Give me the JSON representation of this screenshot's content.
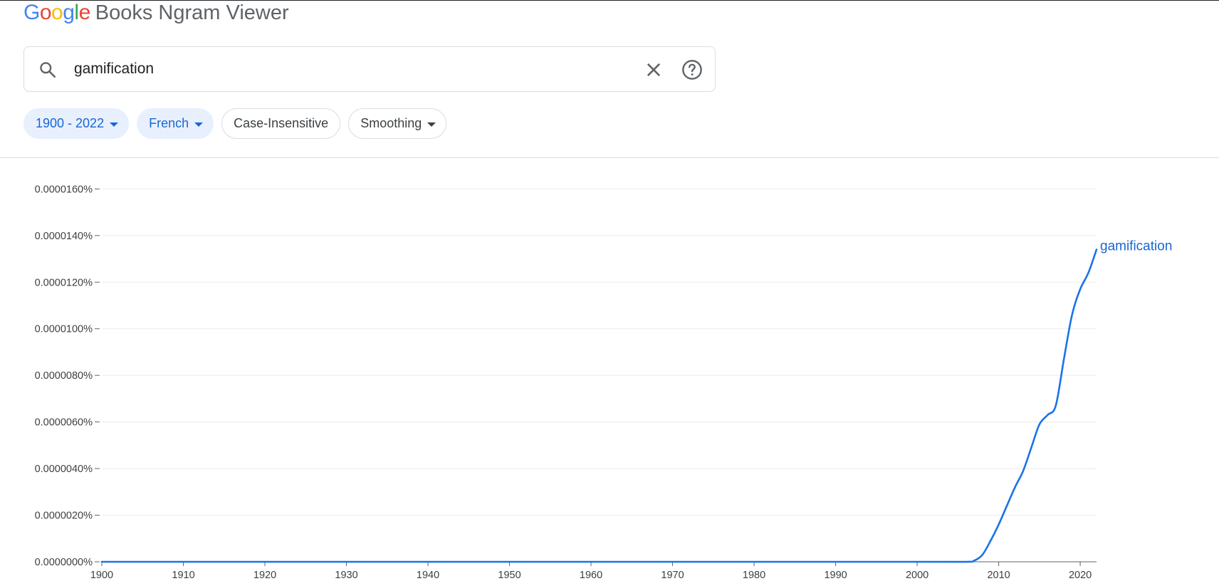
{
  "header": {
    "logo_google": [
      "G",
      "o",
      "o",
      "g",
      "l",
      "e"
    ],
    "logo_colors": [
      "#4285f4",
      "#ea4335",
      "#fbbc05",
      "#4285f4",
      "#34a853",
      "#ea4335"
    ],
    "product_name": "Books Ngram Viewer"
  },
  "search": {
    "value": "gamification",
    "icons": {
      "search": "search-icon",
      "clear": "close-icon",
      "help": "help-icon"
    }
  },
  "filters": {
    "year_range": "1900 - 2022",
    "corpus": "French",
    "case": "Case-Insensitive",
    "smoothing": "Smoothing"
  },
  "colors": {
    "accent": "#1967d2",
    "series": "#1a73e8",
    "chip_selected_bg": "#e8f0fe"
  },
  "chart_data": {
    "type": "line",
    "title": "",
    "xlabel": "",
    "ylabel": "",
    "xlim": [
      1900,
      2022
    ],
    "ylim": [
      0,
      0.000165
    ],
    "x_ticks": [
      1900,
      1910,
      1920,
      1930,
      1940,
      1950,
      1960,
      1970,
      1980,
      1990,
      2000,
      2010,
      2020
    ],
    "y_ticks": [
      0,
      2e-05,
      4e-05,
      6e-05,
      8e-05,
      0.0001,
      0.00012,
      0.00014,
      0.00016
    ],
    "y_tick_labels": [
      "0.0000000%",
      "0.0000020%",
      "0.0000040%",
      "0.0000060%",
      "0.0000080%",
      "0.0000100%",
      "0.0000120%",
      "0.0000140%",
      "0.0000160%"
    ],
    "grid": true,
    "series": [
      {
        "name": "gamification",
        "x": [
          1900,
          1950,
          2000,
          2006,
          2007,
          2008,
          2009,
          2010,
          2011,
          2012,
          2013,
          2014,
          2015,
          2016,
          2017,
          2018,
          2019,
          2020,
          2021,
          2022
        ],
        "values": [
          0,
          0,
          0,
          0,
          5e-07,
          3e-06,
          9e-06,
          1.6e-05,
          2.4e-05,
          3.2e-05,
          3.9e-05,
          4.9e-05,
          5.9e-05,
          6.3e-05,
          6.7e-05,
          8.7e-05,
          0.000106,
          0.000117,
          0.000124,
          0.000134
        ]
      }
    ]
  }
}
